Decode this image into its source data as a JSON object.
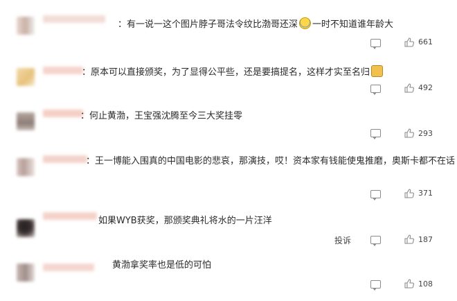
{
  "comments": [
    {
      "text": "有一说一这个图片脖子哥法令纹比渤哥还深",
      "text_after": "一时不知道谁年龄大",
      "emoji": "laugh-cry",
      "likes": "661"
    },
    {
      "text": "原本可以直接颁奖，为了显得公平些，还是要搞提名，这样才实至名归",
      "emoji": "dog",
      "likes": "492"
    },
    {
      "text": "何止黄渤，王宝强沈腾至今三大奖挂零",
      "likes": "293"
    },
    {
      "text": "王一博能入围真的中国电影的悲哀，那演技，哎！资本家有钱能使鬼推磨，奥斯卡都不在话",
      "likes": "371"
    },
    {
      "text": "如果WYB获奖，那颁奖典礼将水的一片汪洋",
      "report": "投诉",
      "likes": "187"
    },
    {
      "text": "黄渤拿奖率也是低的可怕",
      "likes": "108"
    }
  ],
  "colors": {
    "text": "#2a2a2a",
    "meta": "#444444",
    "blur_name": "#f6c9c0"
  }
}
